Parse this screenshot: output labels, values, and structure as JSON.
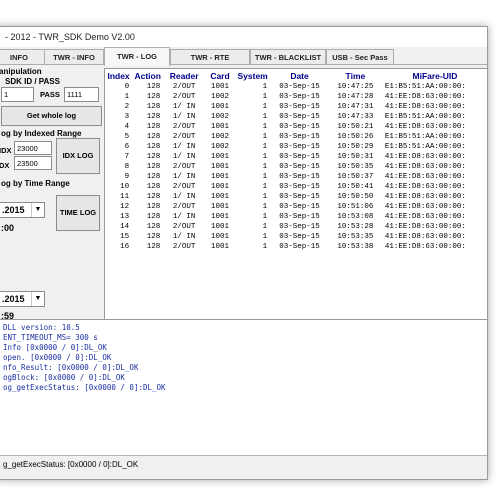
{
  "window": {
    "title": "- 2012 - TWR_SDK Demo V2.00"
  },
  "tabs": [
    {
      "label": "INFO"
    },
    {
      "label": "TWR - INFO"
    },
    {
      "label": "TWR - LOG"
    },
    {
      "label": "TWR - RTE"
    },
    {
      "label": "TWR - BLACKLIST"
    },
    {
      "label": "USB - Sec Pass"
    }
  ],
  "left": {
    "manip_label": "anipulation",
    "sdk_label": "SDK ID / PASS",
    "sdk_id": "1",
    "pass_label": "PASS",
    "pass_value": "1111",
    "get_whole_log": "Get whole log",
    "idx_group": "og by Indexed Range",
    "idx_label": "IDX",
    "idx_from": "23000",
    "idx_to_label": "DX",
    "idx_to": "23500",
    "idx_log_button": "IDX LOG",
    "time_group": "og by Time Range",
    "date_from": ".2015",
    "time_from": ":00",
    "time_log_button": "TIME LOG",
    "date_to": ".2015",
    "time_to": ":59"
  },
  "table": {
    "headers": [
      "Index",
      "Action",
      "Reader",
      "Card",
      "System",
      "Date",
      "Time",
      "MiFare-UID"
    ],
    "rows": [
      [
        "0",
        "128",
        "2/OUT",
        "1001",
        "1",
        "03-Sep-15",
        "10:47:25",
        "E1:B5:51:AA:00:00:"
      ],
      [
        "1",
        "128",
        "2/OUT",
        "1002",
        "1",
        "03-Sep-15",
        "10:47:28",
        "41:EE:D8:63:00:00:"
      ],
      [
        "2",
        "128",
        "1/ IN",
        "1001",
        "1",
        "03-Sep-15",
        "10:47:31",
        "41:EE:D8:63:00:00:"
      ],
      [
        "3",
        "128",
        "1/ IN",
        "1002",
        "1",
        "03-Sep-15",
        "10:47:33",
        "E1:B5:51:AA:00:00:"
      ],
      [
        "4",
        "128",
        "2/OUT",
        "1001",
        "1",
        "03-Sep-15",
        "10:50:21",
        "41:EE:D8:63:00:00:"
      ],
      [
        "5",
        "128",
        "2/OUT",
        "1002",
        "1",
        "03-Sep-15",
        "10:50:26",
        "E1:B5:51:AA:00:00:"
      ],
      [
        "6",
        "128",
        "1/ IN",
        "1002",
        "1",
        "03-Sep-15",
        "10:50:29",
        "E1:B5:51:AA:00:00:"
      ],
      [
        "7",
        "128",
        "1/ IN",
        "1001",
        "1",
        "03-Sep-15",
        "10:50:31",
        "41:EE:D8:63:00:00:"
      ],
      [
        "8",
        "128",
        "2/OUT",
        "1001",
        "1",
        "03-Sep-15",
        "10:50:35",
        "41:EE:D8:63:00:00:"
      ],
      [
        "9",
        "128",
        "1/ IN",
        "1001",
        "1",
        "03-Sep-15",
        "10:50:37",
        "41:EE:D8:63:00:00:"
      ],
      [
        "10",
        "128",
        "2/OUT",
        "1001",
        "1",
        "03-Sep-15",
        "10:50:41",
        "41:EE:D8:63:00:00:"
      ],
      [
        "11",
        "128",
        "1/ IN",
        "1001",
        "1",
        "03-Sep-15",
        "10:50:50",
        "41:EE:D8:63:00:00:"
      ],
      [
        "12",
        "128",
        "2/OUT",
        "1001",
        "1",
        "03-Sep-15",
        "10:51:06",
        "41:EE:D8:63:00:00:"
      ],
      [
        "13",
        "128",
        "1/ IN",
        "1001",
        "1",
        "03-Sep-15",
        "10:53:08",
        "41:EE:D8:63:00:00:"
      ],
      [
        "14",
        "128",
        "2/OUT",
        "1001",
        "1",
        "03-Sep-15",
        "10:53:28",
        "41:EE:D8:63:00:00:"
      ],
      [
        "15",
        "128",
        "1/ IN",
        "1001",
        "1",
        "03-Sep-15",
        "10:53:35",
        "41:EE:D8:63:00:00:"
      ],
      [
        "16",
        "128",
        "2/OUT",
        "1001",
        "1",
        "03-Sep-15",
        "10:53:38",
        "41:EE:D8:63:00:00:"
      ]
    ]
  },
  "console": {
    "lines": [
      "DLL version: 10.5",
      "ENT_TIMEOUT_MS= 300 s",
      "Info [0x0000 / 0]:DL_OK",
      "open. [0x0000 / 0]:DL_OK",
      "nfo_Result: [0x0000 / 0]:DL_OK",
      "ogBlock: [0x0000 / 0]:DL_OK",
      "og_getExecStatus: [0x0000 / 0]:DL_OK"
    ]
  },
  "status": {
    "text": "g_getExecStatus: [0x0000 / 0]:DL_OK"
  }
}
